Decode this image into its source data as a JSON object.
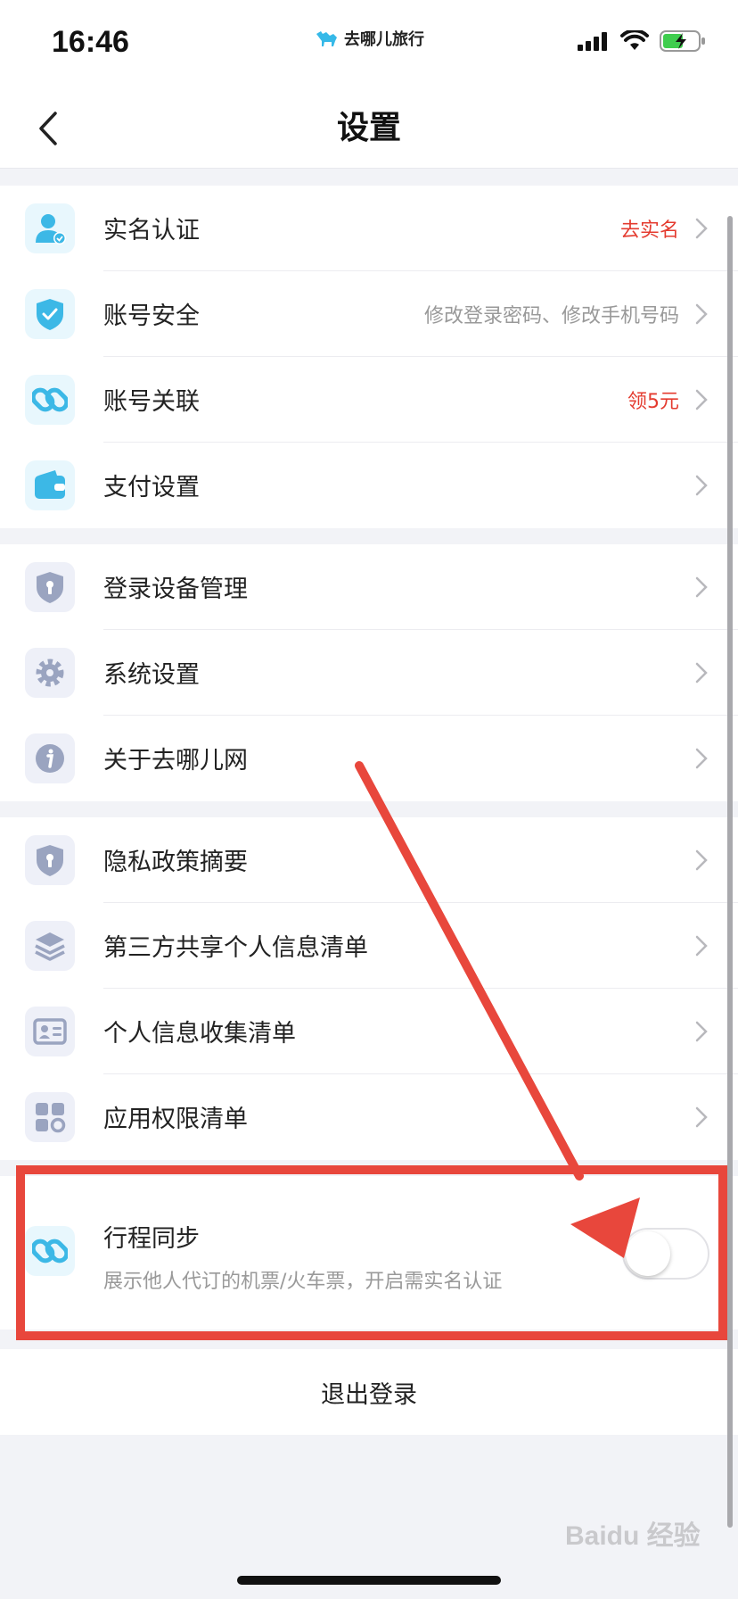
{
  "status_bar": {
    "time": "16:46",
    "carrier": "去哪儿旅行"
  },
  "nav": {
    "title": "设置"
  },
  "sections": [
    [
      {
        "label": "实名认证",
        "right": "去实名",
        "right_color": "#e43b2f",
        "icon": "verified-user-icon"
      },
      {
        "label": "账号安全",
        "right": "修改登录密码、修改手机号码",
        "right_color": "#999999",
        "icon": "shield-check-icon"
      },
      {
        "label": "账号关联",
        "right": "领5元",
        "right_color": "#e43b2f",
        "icon": "link-icon"
      },
      {
        "label": "支付设置",
        "right": "",
        "icon": "wallet-icon"
      }
    ],
    [
      {
        "label": "登录设备管理",
        "icon": "shield-keyhole-icon"
      },
      {
        "label": "系统设置",
        "icon": "gear-icon"
      },
      {
        "label": "关于去哪儿网",
        "icon": "info-icon"
      }
    ],
    [
      {
        "label": "隐私政策摘要",
        "icon": "shield-keyhole-icon"
      },
      {
        "label": "第三方共享个人信息清单",
        "icon": "layers-icon"
      },
      {
        "label": "个人信息收集清单",
        "icon": "id-card-icon"
      },
      {
        "label": "应用权限清单",
        "icon": "grid-apps-icon"
      }
    ]
  ],
  "sync": {
    "label": "行程同步",
    "subtitle": "展示他人代订的机票/火车票，开启需实名认证",
    "enabled": false
  },
  "logout_label": "退出登录",
  "watermark": "Baidu 经验",
  "colors": {
    "accent_red": "#e43b2f",
    "icon_blue": "#3cb8e6",
    "icon_grey": "#9aa4c0",
    "annotation_red": "#e8473c"
  }
}
